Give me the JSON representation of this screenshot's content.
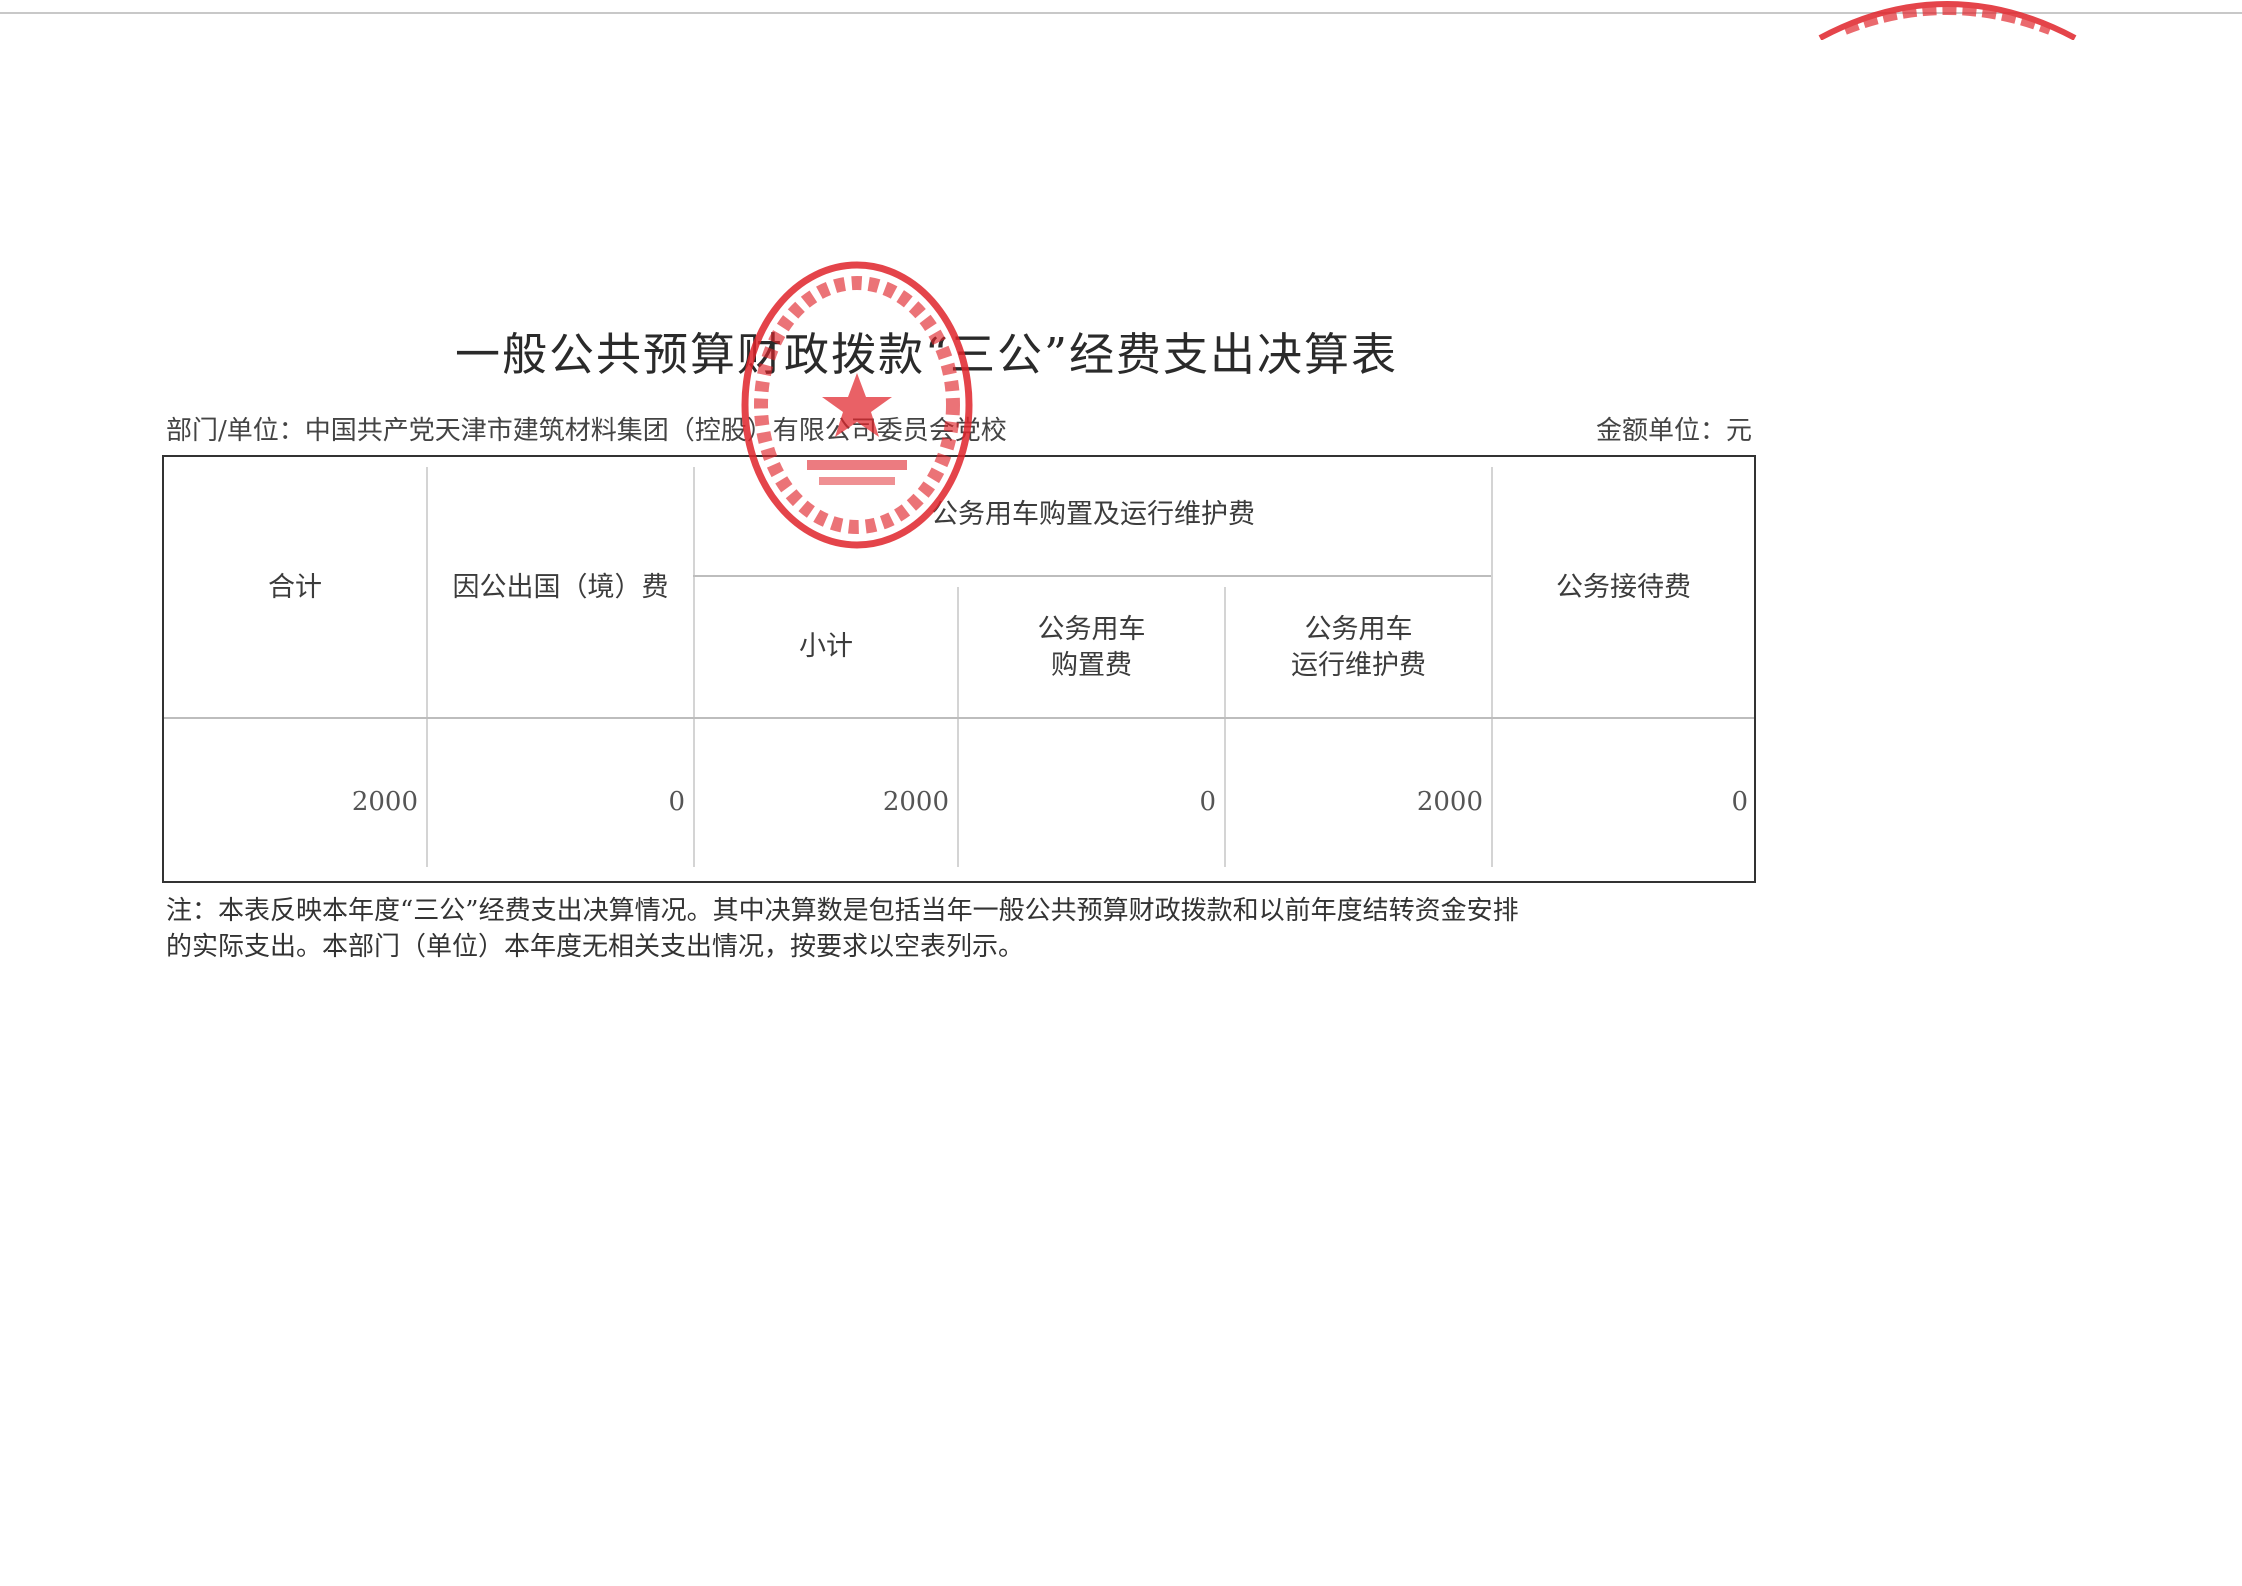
{
  "title": "一般公共预算财政拨款“三公”经费支出决算表",
  "department_label": "部门/单位：中国共产党天津市建筑材料集团（控股）有限公司委员会党校",
  "unit_label": "金额单位：元",
  "table": {
    "headers": {
      "total": "合计",
      "overseas": "因公出国（境）费",
      "vehicle_group": "公务用车购置及运行维护费",
      "subtotal": "小计",
      "vehicle_purchase_line1": "公务用车",
      "vehicle_purchase_line2": "购置费",
      "vehicle_operation_line1": "公务用车",
      "vehicle_operation_line2": "运行维护费",
      "reception": "公务接待费"
    },
    "row": {
      "total": "2000",
      "overseas": "0",
      "subtotal": "2000",
      "vehicle_purchase": "0",
      "vehicle_operation": "2000",
      "reception": "0"
    }
  },
  "note": {
    "line1": "注：本表反映本年度“三公”经费支出决算情况。其中决算数是包括当年一般公共预算财政拨款和以前年度结转资金安排",
    "line2": "的实际支出。本部门（单位）本年度无相关支出情况，按要求以空表列示。"
  },
  "seal_color": "#e0242b"
}
